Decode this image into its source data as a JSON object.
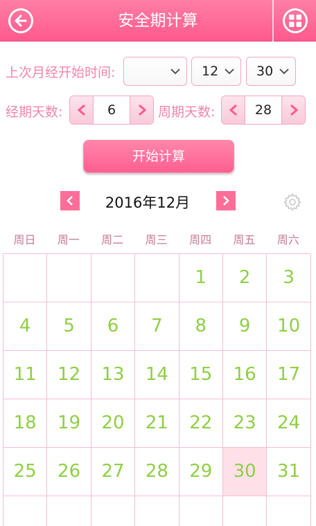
{
  "header": {
    "title": "安全期计算",
    "accent": "#ff6e98"
  },
  "form": {
    "last_period_label": "上次月经开始时间:",
    "year_select": "",
    "month_select": "12",
    "day_select": "30",
    "period_days_label": "经期天数:",
    "period_days": "6",
    "cycle_days_label": "周期天数:",
    "cycle_days": "28",
    "calc_button": "开始计算"
  },
  "calendar": {
    "month_title": "2016年12月",
    "weekdays": [
      "周日",
      "周一",
      "周二",
      "周三",
      "周四",
      "周五",
      "周六"
    ],
    "weeks": [
      [
        "",
        "",
        "",
        "",
        "1",
        "2",
        "3"
      ],
      [
        "4",
        "5",
        "6",
        "7",
        "8",
        "9",
        "10"
      ],
      [
        "11",
        "12",
        "13",
        "14",
        "15",
        "16",
        "17"
      ],
      [
        "18",
        "19",
        "20",
        "21",
        "22",
        "23",
        "24"
      ],
      [
        "25",
        "26",
        "27",
        "28",
        "29",
        "30",
        "31"
      ],
      [
        "",
        "",
        "",
        "",
        "",
        "",
        ""
      ]
    ],
    "selected_day": "30",
    "day_color": "#8fcf45"
  }
}
